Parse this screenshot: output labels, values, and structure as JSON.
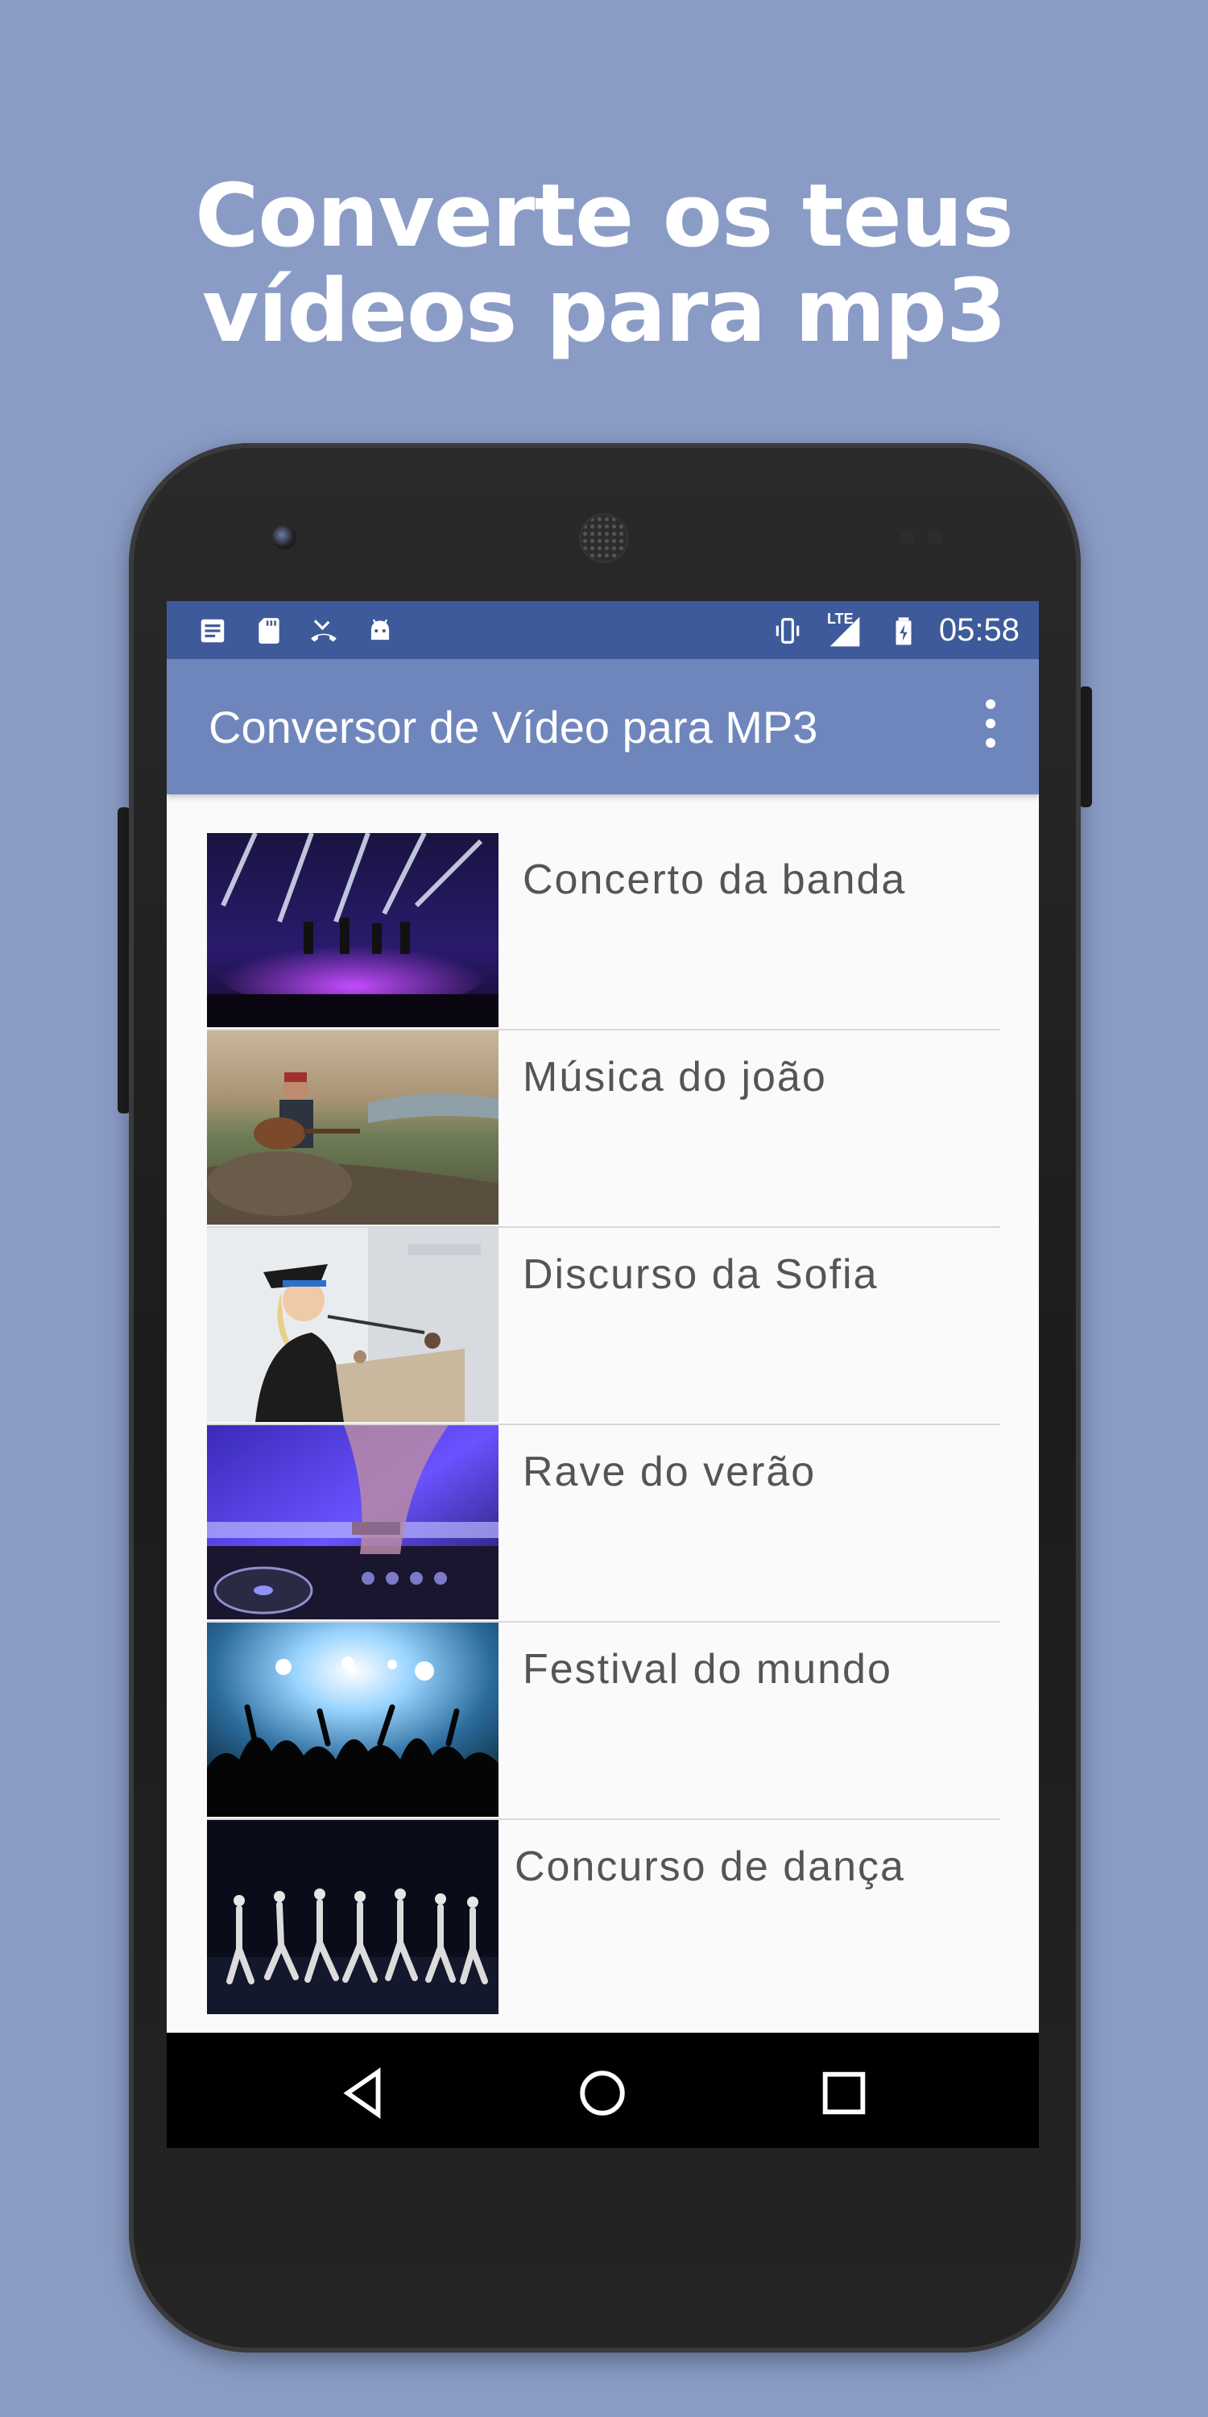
{
  "headline": {
    "line1": "Converte os teus",
    "line2": "vídeos para mp3"
  },
  "statusbar": {
    "time": "05:58",
    "network": "LTE",
    "left_icons": [
      "notes-icon",
      "sd-card-icon",
      "missed-call-icon",
      "android-icon"
    ],
    "right_icons": [
      "vibrate-icon",
      "signal-icon",
      "battery-icon"
    ]
  },
  "appbar": {
    "title": "Conversor de Vídeo para MP3",
    "overflow_icon": "more-vert-icon"
  },
  "videos": [
    {
      "title": "Concerto da banda"
    },
    {
      "title": "Música do joão"
    },
    {
      "title": "Discurso da Sofia"
    },
    {
      "title": "Rave do verão"
    },
    {
      "title": "Festival do mundo"
    },
    {
      "title": "Concurso de dança"
    }
  ],
  "navbar": {
    "back_icon": "back-icon",
    "home_icon": "home-icon",
    "recents_icon": "recents-icon"
  },
  "colors": {
    "background": "#8a9cc6",
    "statusbar": "#3f5a9a",
    "appbar": "#6f86bd",
    "list_text": "#555555"
  }
}
